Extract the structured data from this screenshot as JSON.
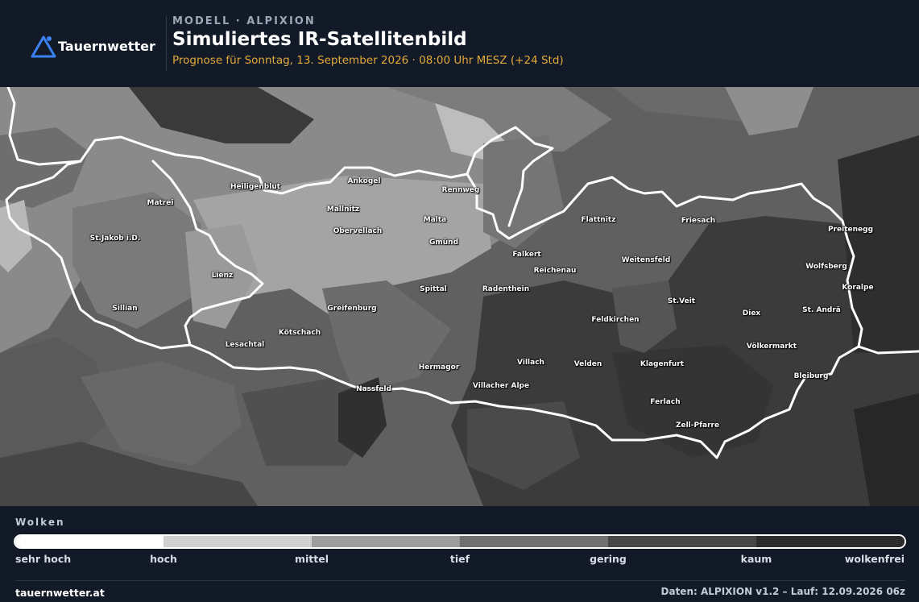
{
  "header": {
    "brand": "Tauernwetter",
    "kicker": "MODELL · ALPIXION",
    "title": "Simuliertes IR-Satellitenbild",
    "subtitle": "Prognose für Sonntag, 13. September 2026 · 08:00 Uhr MESZ  (+24 Std)",
    "brand_color": "#3b82f6",
    "subtitle_color": "#e3a93a",
    "icon": "mountain-logo-icon"
  },
  "map": {
    "towns": [
      "Heiligenblut",
      "Ankogel",
      "Rennweg",
      "Matrei",
      "Mallnitz",
      "Malta",
      "St.Jakob i.D.",
      "Obervellach",
      "Gmünd",
      "Flattnitz",
      "Friesach",
      "Preitenegg",
      "Falkert",
      "Weitensfeld",
      "Reichenau",
      "Wolfsberg",
      "Lienz",
      "Spittal",
      "Radenthein",
      "Koralpe",
      "Sillian",
      "St.Veit",
      "Greifenburg",
      "Diex",
      "St. Andrä",
      "Feldkirchen",
      "Kötschach",
      "Lesachtal",
      "Völkermarkt",
      "Villach",
      "Velden",
      "Klagenfurt",
      "Hermagor",
      "Bleiburg",
      "Villacher Alpe",
      "Nassfeld",
      "Ferlach",
      "Zell-Pfarre"
    ],
    "border_color": "#ffffff"
  },
  "legend": {
    "title": "Wolken",
    "levels": [
      {
        "label": "sehr hoch",
        "color": "#ffffff"
      },
      {
        "label": "hoch",
        "color": "#d0d0d0"
      },
      {
        "label": "mittel",
        "color": "#9c9c9c"
      },
      {
        "label": "tief",
        "color": "#6f6f6f"
      },
      {
        "label": "gering",
        "color": "#474747"
      },
      {
        "label": "kaum",
        "color": "#2c2c2c"
      },
      {
        "label": "wolkenfrei",
        "color": "#1a1a1a"
      }
    ]
  },
  "footer": {
    "website": "tauernwetter.at",
    "run_info": "Daten: ALPIXION v1.2 – Lauf: 12.09.2026 06z"
  }
}
